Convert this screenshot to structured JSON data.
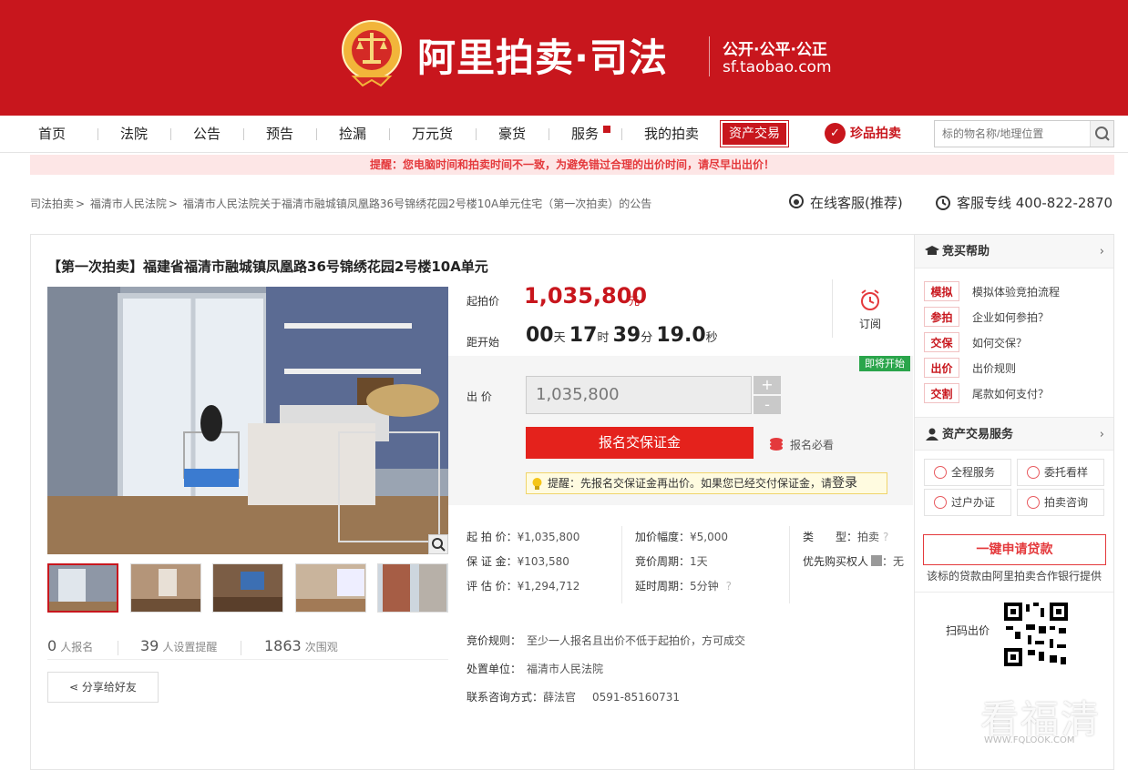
{
  "brand": {
    "name": "阿里拍卖·司法",
    "slogan": "公开·公平·公正",
    "domain": "sf.taobao.com"
  },
  "nav": {
    "items": [
      "首页",
      "法院",
      "公告",
      "预告",
      "捡漏",
      "万元货",
      "豪货",
      "服务",
      "我的拍卖"
    ],
    "asset": "资产交易",
    "treasure": "珍品拍卖",
    "search_placeholder": "标的物名称/地理位置"
  },
  "warning": "提醒：您电脑时间和拍卖时间不一致，为避免错过合理的出价时间，请尽早出出价！",
  "breadcrumb": [
    "司法拍卖",
    "福清市人民法院",
    "福清市人民法院关于福清市融城镇凤凰路36号锦绣花园2号楼10A单元住宅（第一次拍卖）的公告"
  ],
  "service": {
    "online": "在线客服(推荐)",
    "phone": "客服专线 400-822-2870"
  },
  "item": {
    "title": "【第一次拍卖】福建省福清市融城镇凤凰路36号锦绣花园2号楼10A单元",
    "start_price_label": "起拍价",
    "start_price": "1,035,800",
    "price_unit": "元",
    "countdown_label": "距开始",
    "countdown": {
      "days": "00",
      "d_unit": "天",
      "hours": "17",
      "h_unit": "时",
      "minutes": "39",
      "m_unit": "分",
      "seconds": "19.0",
      "s_unit": "秒"
    },
    "subscribe": "订阅",
    "soon_badge": "即将开始",
    "bid_label": "出  价",
    "bid_value": "1,035,800",
    "plus": "+",
    "minus": "-",
    "signup_button": "报名交保证金",
    "must_read": "报名必看",
    "tip_text": "提醒：先报名交保证金再出价。如果您已经交付保证金，请",
    "tip_link": "登录"
  },
  "stats": {
    "signups": "0",
    "signups_label": "人报名",
    "reminders": "39",
    "reminders_label": "人设置提醒",
    "views": "1863",
    "views_label": "次围观"
  },
  "share": "分享给好友",
  "details": {
    "start_k": "起 拍 价：",
    "start_v": "¥1,035,800",
    "deposit_k": "保 证 金：",
    "deposit_v": "¥103,580",
    "assess_k": "评 估 价：",
    "assess_v": "¥1,294,712",
    "increment_k": "加价幅度：",
    "increment_v": "¥5,000",
    "cycle_k": "竞价周期：",
    "cycle_v": "1天",
    "delay_k": "延时周期：",
    "delay_v": "5分钟",
    "type_k": "类　　型：",
    "type_v": "拍卖",
    "priority_k": "优先购买权人",
    "priority_v": "：无",
    "rule_k": "竞价规则：",
    "rule_v": "至少一人报名且出价不低于起拍价，方可成交",
    "unit_k": "处置单位：",
    "unit_v": "福清市人民法院",
    "contact_k": "联系咨询方式：",
    "contact_name": "薛法官",
    "contact_phone": "0591-85160731"
  },
  "sidebar": {
    "help_title": "竞买帮助",
    "help": [
      {
        "tag": "模拟",
        "text": "模拟体验竞拍流程"
      },
      {
        "tag": "参拍",
        "text": "企业如何参拍？"
      },
      {
        "tag": "交保",
        "text": "如何交保？"
      },
      {
        "tag": "出价",
        "text": "出价规则"
      },
      {
        "tag": "交割",
        "text": "尾款如何支付？"
      }
    ],
    "asset_title": "资产交易服务",
    "services": [
      "全程服务",
      "委托看样",
      "过户办证",
      "拍卖咨询"
    ],
    "loan_button": "一键申请贷款",
    "loan_note": "该标的贷款由阿里拍卖合作银行提供",
    "qr_label": "扫码出价"
  },
  "watermark": {
    "text": "看福清",
    "url": "WWW.FQLOOK.COM"
  }
}
